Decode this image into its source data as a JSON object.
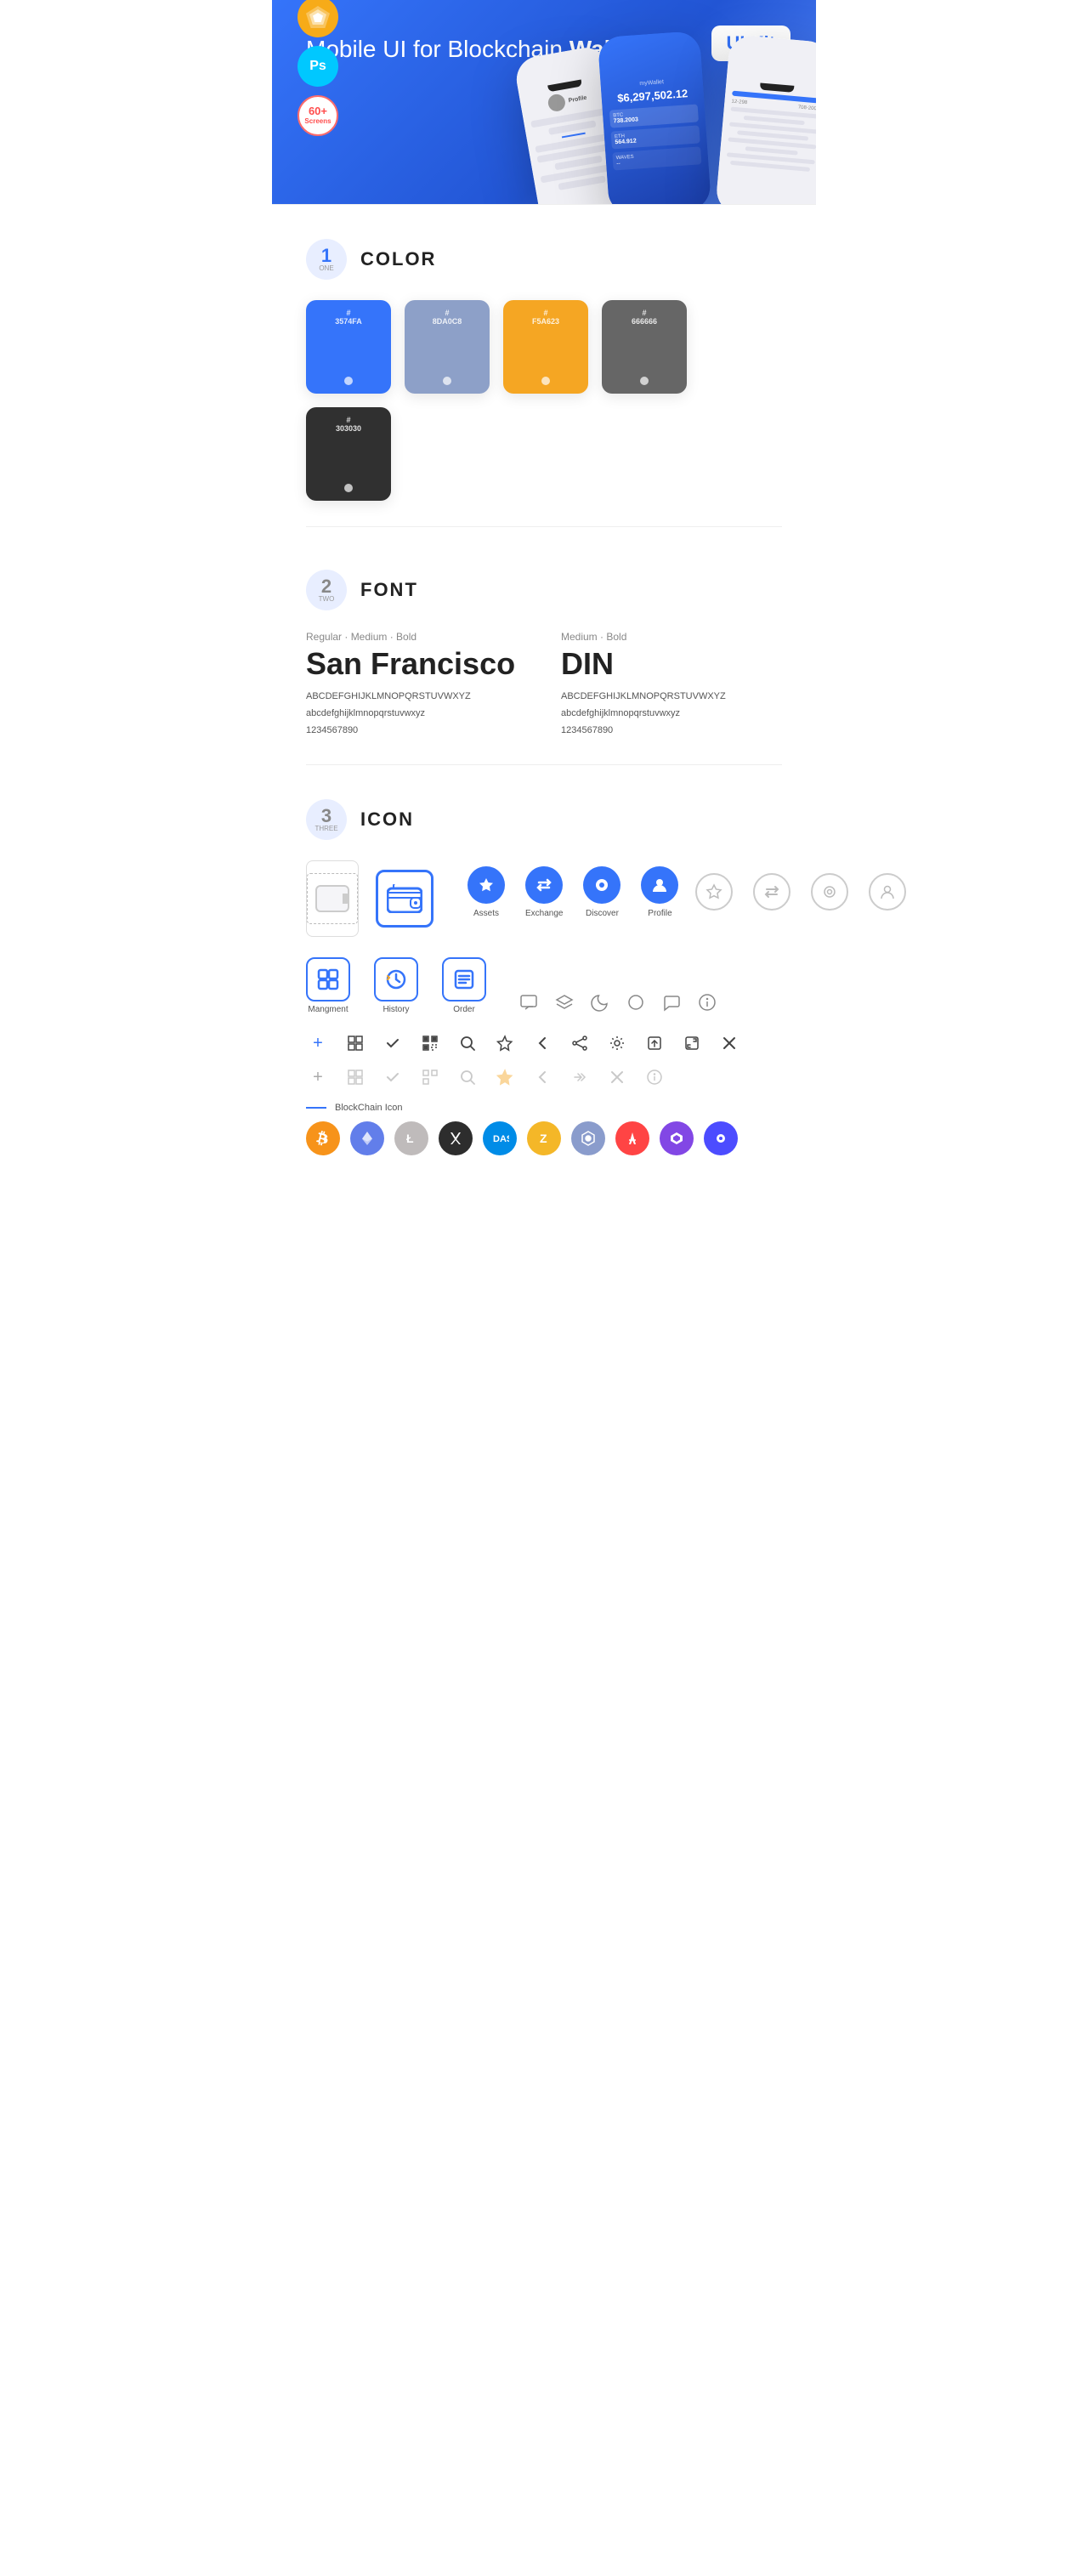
{
  "hero": {
    "title": "Mobile UI for Blockchain ",
    "title_bold": "Wallet",
    "badge": "UI Kit",
    "sketch_label": "Sk",
    "ps_label": "Ps",
    "screens_label": "60+\nScreens"
  },
  "sections": {
    "color": {
      "number": "1",
      "sub": "ONE",
      "title": "COLOR",
      "swatches": [
        {
          "code": "#\n3574FA",
          "class": "swatch-blue"
        },
        {
          "code": "#\n8DA0C8",
          "class": "swatch-gray-blue"
        },
        {
          "code": "#\nF5A623",
          "class": "swatch-orange"
        },
        {
          "code": "#\n666666",
          "class": "swatch-gray"
        },
        {
          "code": "#\n303030",
          "class": "swatch-dark"
        }
      ]
    },
    "font": {
      "number": "2",
      "sub": "TWO",
      "title": "FONT",
      "col1": {
        "style": "Regular · Medium · Bold",
        "name": "San Francisco",
        "uppercase": "ABCDEFGHIJKLMNOPQRSTUVWXYZ",
        "lowercase": "abcdefghijklmnopqrstuvwxyz",
        "numbers": "1234567890"
      },
      "col2": {
        "style": "Medium · Bold",
        "name": "DIN",
        "uppercase": "ABCDEFGHIJKLMNOPQRSTUVWXYZ",
        "lowercase": "abcdefghijklmnopqrstuvwxyz",
        "numbers": "1234567890"
      }
    },
    "icon": {
      "number": "3",
      "sub": "THREE",
      "title": "ICON",
      "nav_items": [
        {
          "label": "Assets",
          "icon": "◆"
        },
        {
          "label": "Exchange",
          "icon": "⇄"
        },
        {
          "label": "Discover",
          "icon": "●"
        },
        {
          "label": "Profile",
          "icon": "👤"
        }
      ],
      "app_icons": [
        {
          "label": "Mangment",
          "icon": "▣"
        },
        {
          "label": "History",
          "icon": "⏱"
        },
        {
          "label": "Order",
          "icon": "≡"
        }
      ],
      "blockchain_label": "BlockChain Icon",
      "crypto_coins": [
        "BTC",
        "ETH",
        "LTC",
        "NEO",
        "DASH",
        "ZEC",
        "QTUM",
        "ARK",
        "MATIC",
        "POLY",
        "WAVES"
      ]
    }
  }
}
